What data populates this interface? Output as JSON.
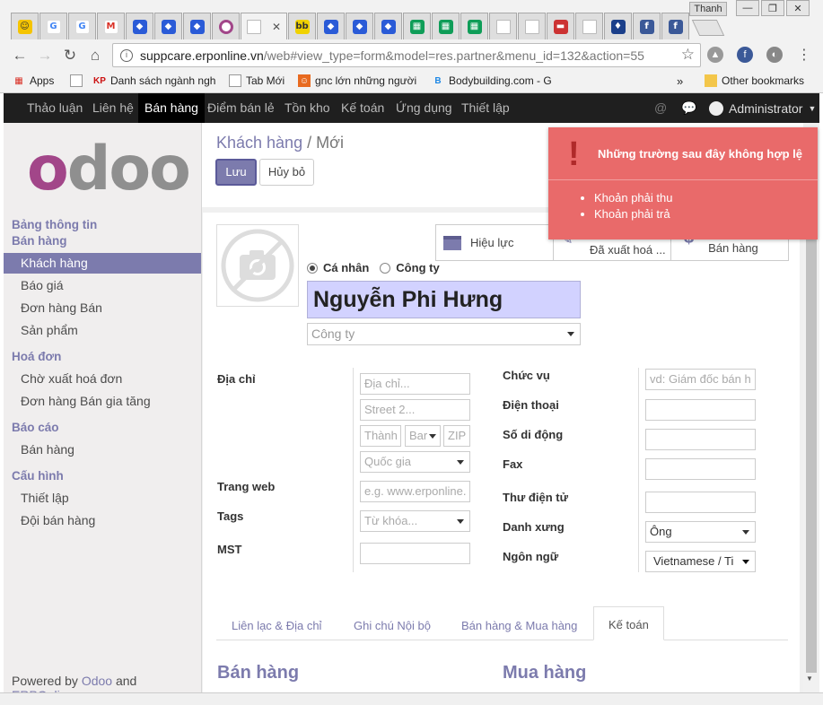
{
  "browser": {
    "profile": "Thanh",
    "url_host": "suppcare.erponline.vn",
    "url_path": "/web#view_type=form&model=res.partner&menu_id=132&action=55",
    "bookmarks": [
      "Apps",
      "Danh sách ngành ngh",
      "Tab Mới",
      "gnc lớn những người",
      "Bodybuilding.com - G",
      "Other bookmarks"
    ]
  },
  "topnav": {
    "items": [
      "Thảo luận",
      "Liên hệ",
      "Bán hàng",
      "Điểm bán lẻ",
      "Tồn kho",
      "Kế toán",
      "Ứng dụng",
      "Thiết lập"
    ],
    "user": "Administrator"
  },
  "sidebar": {
    "logo": "odoo",
    "sections": [
      {
        "title_line1": "Bảng thông tin",
        "title_line2": "Bán hàng",
        "items": [
          "Khách hàng",
          "Báo giá",
          "Đơn hàng Bán",
          "Sản phẩm"
        ]
      },
      {
        "title": "Hoá đơn",
        "items": [
          "Chờ xuất hoá đơn",
          "Đơn hàng Bán gia tăng"
        ]
      },
      {
        "title": "Báo cáo",
        "items": [
          "Bán hàng"
        ]
      },
      {
        "title": "Cấu hình",
        "items": [
          "Thiết lập",
          "Đội bán hàng"
        ]
      }
    ],
    "powered_prefix": "Powered by",
    "powered_odoo": "Odoo",
    "powered_and": "and",
    "powered_erp": "ERPOnline"
  },
  "header": {
    "breadcrumb_parent": "Khách hàng",
    "breadcrumb_sep": "/",
    "breadcrumb_current": "Mới",
    "save": "Lưu",
    "discard": "Hủy bỏ"
  },
  "stats": {
    "active": "Hiệu lực",
    "invoiced_line2": "Đã xuất hoá ...",
    "sales": "Bán hàng"
  },
  "form": {
    "type_person": "Cá nhân",
    "type_company": "Công ty",
    "name": "Nguyễn Phi Hưng",
    "company_placeholder": "Công ty",
    "labels": {
      "address": "Địa chỉ",
      "website": "Trang web",
      "tags": "Tags",
      "tax": "MST",
      "job": "Chức vụ",
      "phone": "Điện thoại",
      "mobile": "Số di động",
      "fax": "Fax",
      "email": "Thư điện tử",
      "title": "Danh xưng",
      "lang": "Ngôn ngữ"
    },
    "placeholders": {
      "street": "Địa chỉ...",
      "street2": "Street 2...",
      "city": "Thành",
      "state": "Bar",
      "zip": "ZIP",
      "country": "Quốc gia",
      "website": "e.g. www.erponline.",
      "tags": "Từ khóa...",
      "job": "vd: Giám đốc bán h"
    },
    "values": {
      "title": "Ông",
      "lang": "Vietnamese / Ti"
    }
  },
  "tabs": [
    "Liên lạc & Địa chỉ",
    "Ghi chú Nội bộ",
    "Bán hàng & Mua hàng",
    "Kế toán"
  ],
  "sections": {
    "sales": "Bán hàng",
    "purchase": "Mua hàng"
  },
  "notification": {
    "title": "Những trường sau đây không hợp lệ",
    "items": [
      "Khoản phải thu",
      "Khoản phải trả"
    ]
  },
  "colors": {
    "accent": "#7c7bad",
    "error": "#e96a6a",
    "nav": "#1f1f1f"
  }
}
